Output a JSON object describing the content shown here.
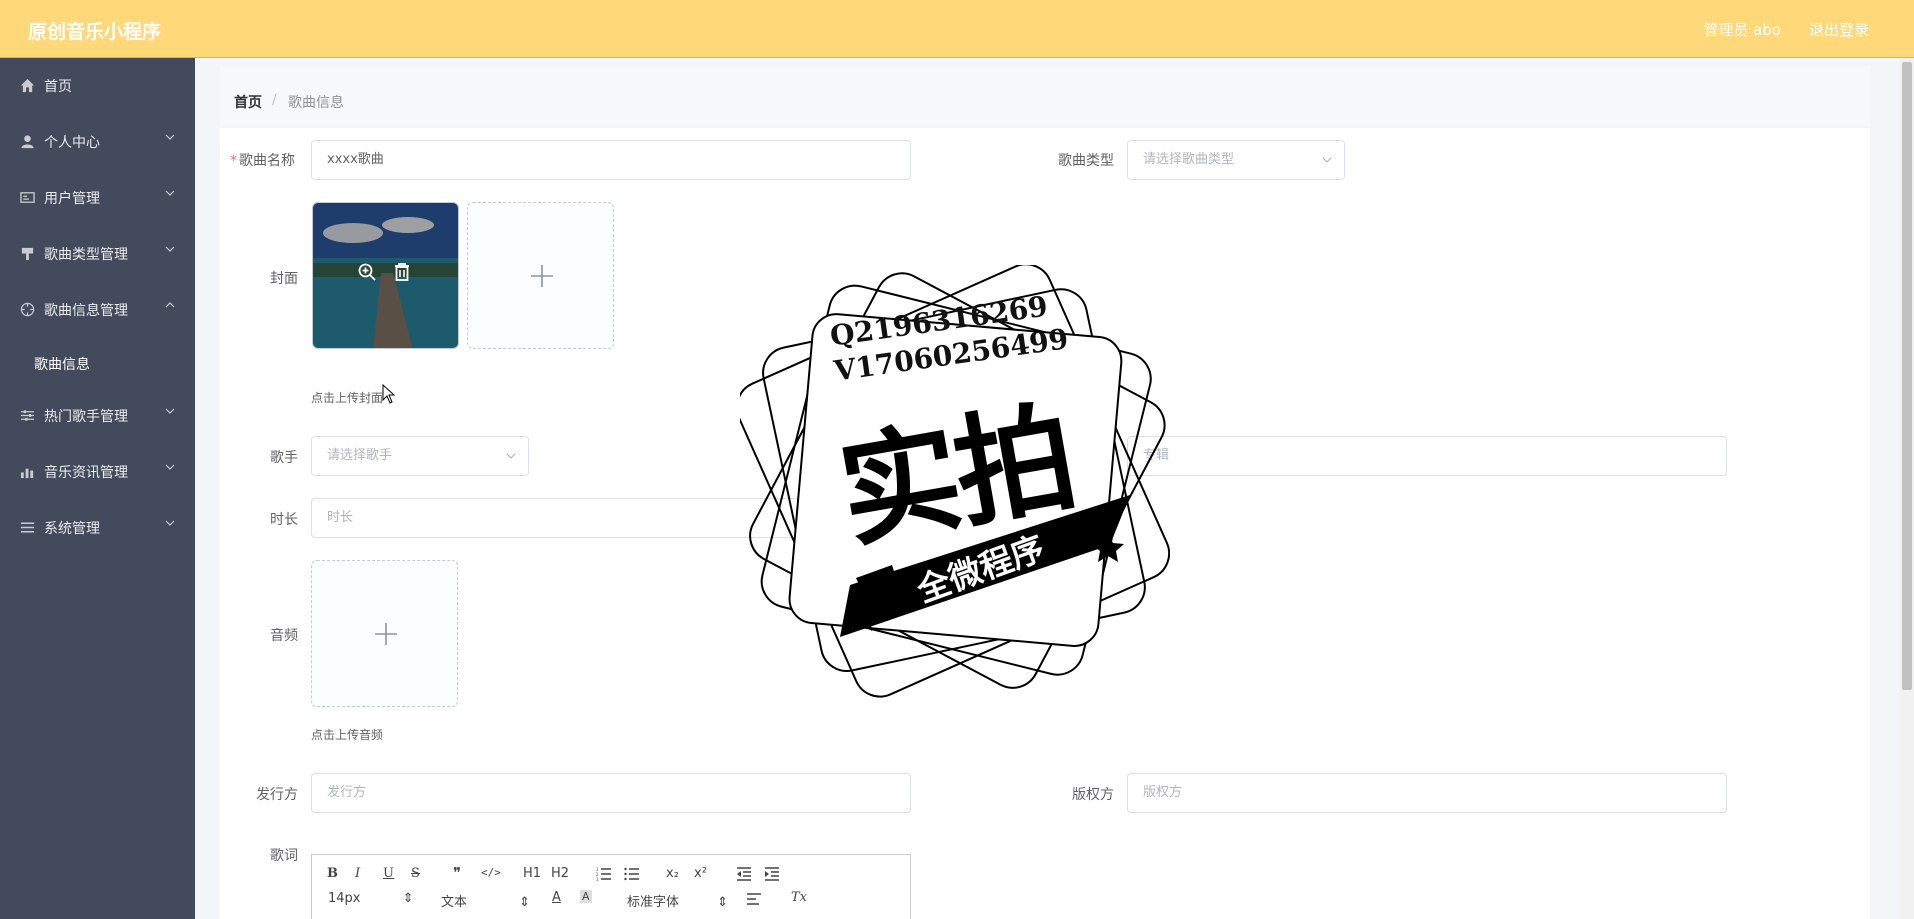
{
  "header": {
    "app_title": "原创音乐小程序",
    "admin_label": "管理员 abo",
    "logout_label": "退出登录"
  },
  "sidebar": {
    "items": [
      {
        "label": "首页",
        "icon": "home-icon"
      },
      {
        "label": "个人中心",
        "icon": "user-icon"
      },
      {
        "label": "用户管理",
        "icon": "id-card-icon"
      },
      {
        "label": "歌曲类型管理",
        "icon": "brush-icon"
      },
      {
        "label": "歌曲信息管理",
        "icon": "compass-icon"
      },
      {
        "label": "热门歌手管理",
        "icon": "sliders-icon"
      },
      {
        "label": "音乐资讯管理",
        "icon": "chart-icon"
      },
      {
        "label": "系统管理",
        "icon": "list-icon"
      }
    ],
    "sub_item": "歌曲信息"
  },
  "breadcrumb": {
    "home": "首页",
    "separator": "/",
    "current": "歌曲信息"
  },
  "form": {
    "song_name_label": "歌曲名称",
    "song_name_value": "xxxx歌曲",
    "song_type_label": "歌曲类型",
    "song_type_placeholder": "请选择歌曲类型",
    "cover_label": "封面",
    "cover_hint": "点击上传封面",
    "singer_label": "歌手",
    "singer_placeholder": "请选择歌手",
    "album_label": "专辑",
    "album_placeholder": "专辑",
    "duration_label": "时长",
    "duration_placeholder": "时长",
    "audio_label": "音频",
    "audio_hint": "点击上传音频",
    "publisher_label": "发行方",
    "publisher_placeholder": "发行方",
    "copyright_label": "版权方",
    "copyright_placeholder": "版权方",
    "lyrics_label": "歌词"
  },
  "editor": {
    "bold": "B",
    "italic": "I",
    "underline": "U",
    "strike": "S",
    "quote": "❞",
    "code": "</>",
    "h1": "H1",
    "h2": "H2",
    "sub": "x₂",
    "sup": "x²",
    "font_size": "14px",
    "text_type": "文本",
    "font_family": "标准字体",
    "clear": "Tx"
  },
  "watermark": {
    "line1": "Q2196316269",
    "line2": "V17060256499",
    "main": "实拍",
    "band": "全微程序"
  },
  "colors": {
    "header_bg": "#ffd87a",
    "sidebar_bg": "#434a5b",
    "required": "#f56c6c"
  }
}
